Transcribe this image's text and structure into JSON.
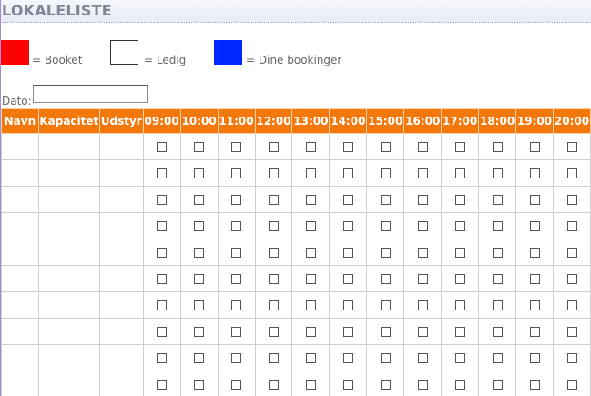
{
  "page": {
    "title": "LOKALELISTE"
  },
  "legend": [
    {
      "label": "= Booket",
      "color": "#ff0000"
    },
    {
      "label": "= Ledig",
      "color": "#ffffff"
    },
    {
      "label": "= Dine bookinger",
      "color": "#0026ff"
    }
  ],
  "date_field": {
    "label": "Dato:",
    "value": ""
  },
  "table": {
    "headers": [
      "Navn",
      "Kapacitet",
      "Udstyr"
    ],
    "times": [
      "09:00",
      "10:00",
      "11:00",
      "12:00",
      "13:00",
      "14:00",
      "15:00",
      "16:00",
      "17:00",
      "18:00",
      "19:00",
      "20:00"
    ],
    "rows": [
      {
        "navn": "",
        "kapacitet": "",
        "udstyr": "",
        "slots_checked": [
          false,
          false,
          false,
          false,
          false,
          false,
          false,
          false,
          false,
          false,
          false,
          false
        ]
      },
      {
        "navn": "",
        "kapacitet": "",
        "udstyr": "",
        "slots_checked": [
          false,
          false,
          false,
          false,
          false,
          false,
          false,
          false,
          false,
          false,
          false,
          false
        ]
      },
      {
        "navn": "",
        "kapacitet": "",
        "udstyr": "",
        "slots_checked": [
          false,
          false,
          false,
          false,
          false,
          false,
          false,
          false,
          false,
          false,
          false,
          false
        ]
      },
      {
        "navn": "",
        "kapacitet": "",
        "udstyr": "",
        "slots_checked": [
          false,
          false,
          false,
          false,
          false,
          false,
          false,
          false,
          false,
          false,
          false,
          false
        ]
      },
      {
        "navn": "",
        "kapacitet": "",
        "udstyr": "",
        "slots_checked": [
          false,
          false,
          false,
          false,
          false,
          false,
          false,
          false,
          false,
          false,
          false,
          false
        ]
      },
      {
        "navn": "",
        "kapacitet": "",
        "udstyr": "",
        "slots_checked": [
          false,
          false,
          false,
          false,
          false,
          false,
          false,
          false,
          false,
          false,
          false,
          false
        ]
      },
      {
        "navn": "",
        "kapacitet": "",
        "udstyr": "",
        "slots_checked": [
          false,
          false,
          false,
          false,
          false,
          false,
          false,
          false,
          false,
          false,
          false,
          false
        ]
      },
      {
        "navn": "",
        "kapacitet": "",
        "udstyr": "",
        "slots_checked": [
          false,
          false,
          false,
          false,
          false,
          false,
          false,
          false,
          false,
          false,
          false,
          false
        ]
      },
      {
        "navn": "",
        "kapacitet": "",
        "udstyr": "",
        "slots_checked": [
          false,
          false,
          false,
          false,
          false,
          false,
          false,
          false,
          false,
          false,
          false,
          false
        ]
      },
      {
        "navn": "",
        "kapacitet": "",
        "udstyr": "",
        "slots_checked": [
          false,
          false,
          false,
          false,
          false,
          false,
          false,
          false,
          false,
          false,
          false,
          false
        ]
      }
    ]
  },
  "colors": {
    "header_bg": "#f2780c",
    "header_text": "#ffffff",
    "title_text": "#7e8796",
    "grid_border": "#cfcfcf"
  }
}
